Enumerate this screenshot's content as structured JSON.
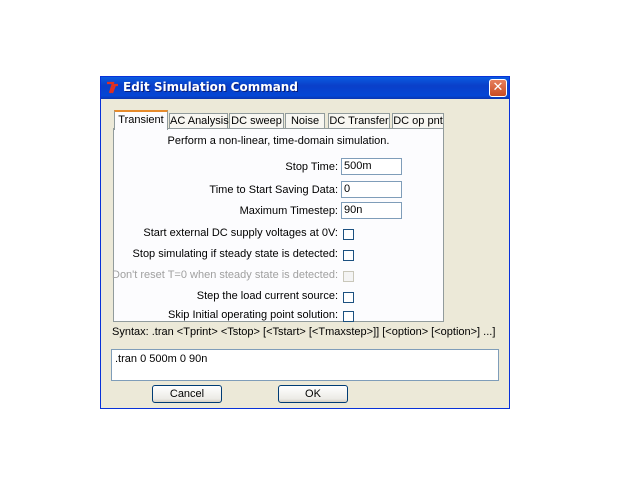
{
  "window": {
    "title": "Edit Simulation Command",
    "close_glyph": "✕",
    "icon": "ltspice-logo-icon"
  },
  "tabs": [
    {
      "label": "Transient",
      "active": true
    },
    {
      "label": "AC Analysis",
      "active": false
    },
    {
      "label": "DC sweep",
      "active": false
    },
    {
      "label": "Noise",
      "active": false
    },
    {
      "label": "DC Transfer",
      "active": false
    },
    {
      "label": "DC op pnt",
      "active": false
    }
  ],
  "transient": {
    "description": "Perform a non-linear, time-domain simulation.",
    "stop_time": {
      "label": "Stop Time:",
      "value": "500m"
    },
    "start_saving": {
      "label": "Time to Start Saving Data:",
      "value": "0"
    },
    "max_timestep": {
      "label": "Maximum Timestep:",
      "value": "90n"
    },
    "options": [
      {
        "label": "Start external DC supply voltages at 0V:",
        "checked": false,
        "enabled": true
      },
      {
        "label": "Stop simulating if steady state is detected:",
        "checked": false,
        "enabled": true
      },
      {
        "label": "Don't reset T=0 when steady state is detected:",
        "checked": false,
        "enabled": false
      },
      {
        "label": "Step the load current source:",
        "checked": false,
        "enabled": true
      },
      {
        "label": "Skip Initial operating point solution:",
        "checked": false,
        "enabled": true
      }
    ]
  },
  "syntax": "Syntax:  .tran <Tprint> <Tstop> [<Tstart> [<Tmaxstep>]] [<option> [<option>] ...]",
  "command": ".tran 0 500m 0 90n",
  "buttons": {
    "cancel": "Cancel",
    "ok": "OK"
  },
  "colors": {
    "titlebar": "#0a3fc9",
    "active_tab_accent": "#e68b2c",
    "dialog_bg": "#ece9d8"
  }
}
